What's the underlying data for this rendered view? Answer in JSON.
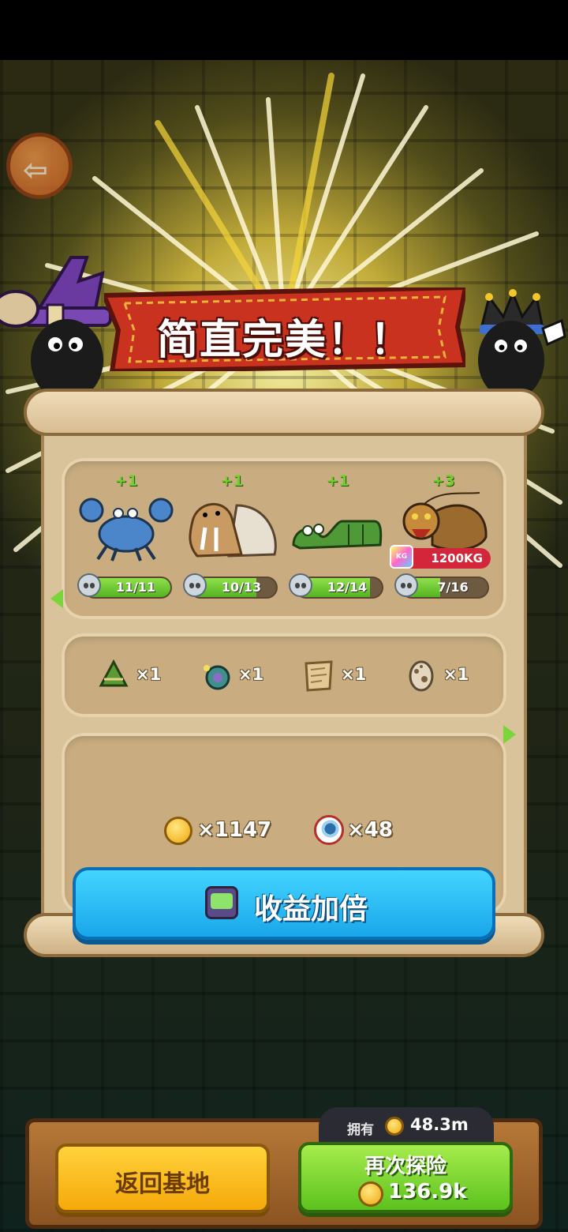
{
  "result": {
    "title": "简直完美！！"
  },
  "caught": [
    {
      "name": "crab",
      "bonus": "+1",
      "progress_text": "11/11",
      "progress": 1.0
    },
    {
      "name": "walrus",
      "bonus": "+1",
      "progress_text": "10/13",
      "progress": 0.77
    },
    {
      "name": "green-snake",
      "bonus": "+1",
      "progress_text": "12/14",
      "progress": 0.86
    },
    {
      "name": "dragon-shrimp",
      "bonus": "+3",
      "progress_text": "7/16",
      "progress": 0.44,
      "weight": "1200KG",
      "weight_badge": "KG"
    }
  ],
  "items": [
    {
      "name": "rice-dumpling",
      "qty": "×1"
    },
    {
      "name": "snail-shell",
      "qty": "×1"
    },
    {
      "name": "parchment",
      "qty": "×1"
    },
    {
      "name": "spotted-egg",
      "qty": "×1"
    }
  ],
  "rewards": {
    "coins": "×1147",
    "eyes": "×48"
  },
  "buttons": {
    "double": "收益加倍",
    "home": "返回基地",
    "again": "再次探险",
    "again_cost": "136.9k"
  },
  "wallet": {
    "label": "拥有",
    "amount": "48.3m"
  },
  "colors": {
    "banner_red": "#c8321f",
    "progress_green": "#7fd63c",
    "double_blue": "#29b9f5",
    "home_yellow": "#fbbd1e",
    "again_green": "#7dd634"
  }
}
